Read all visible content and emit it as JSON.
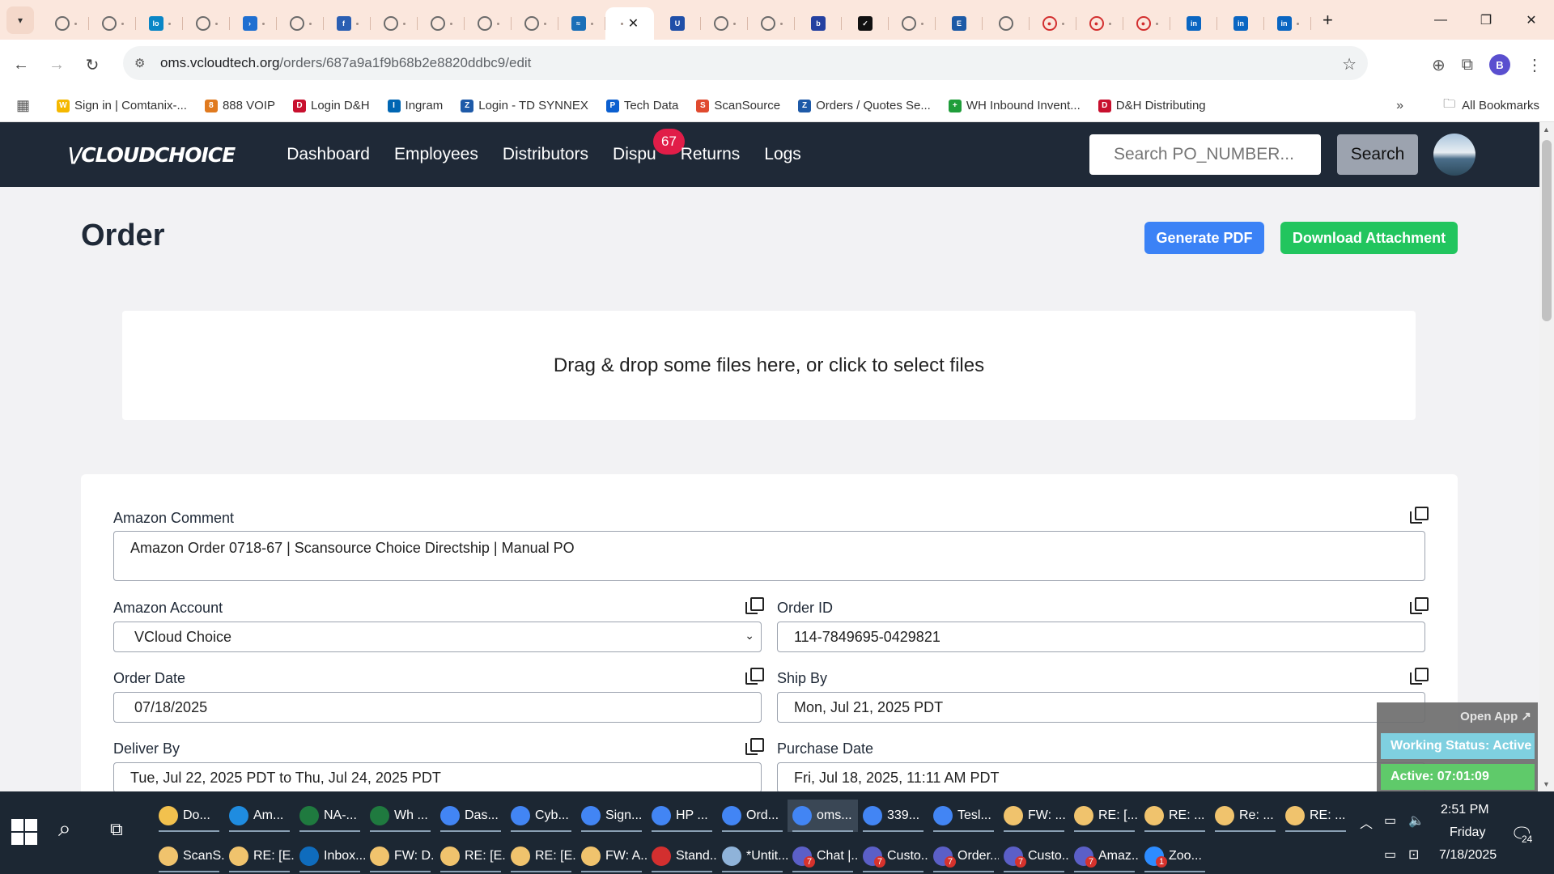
{
  "browser": {
    "active_tab_close": "✕",
    "new_tab": "+",
    "url_host": "oms.vcloudtech.org",
    "url_path": "/orders/687a9a1f9b68b2e8820ddbc9/edit",
    "profile_initial": "B",
    "bookmarks": [
      {
        "label": "Sign in | Comtanix-...",
        "color": "#f5b800",
        "glyph": "W"
      },
      {
        "label": "888 VOIP",
        "color": "#e07a1f",
        "glyph": "8"
      },
      {
        "label": "Login D&H",
        "color": "#c8102e",
        "glyph": "D"
      },
      {
        "label": "Ingram",
        "color": "#0066b3",
        "glyph": "I"
      },
      {
        "label": "Login - TD SYNNEX",
        "color": "#1e5aa8",
        "glyph": "Z"
      },
      {
        "label": "Tech Data",
        "color": "#0b5fd0",
        "glyph": "P"
      },
      {
        "label": "ScanSource",
        "color": "#e04a2f",
        "glyph": "S"
      },
      {
        "label": "Orders / Quotes Se...",
        "color": "#1e5aa8",
        "glyph": "Z"
      },
      {
        "label": "WH Inbound Invent...",
        "color": "#1f9d3a",
        "glyph": "+"
      },
      {
        "label": "D&H Distributing",
        "color": "#c8102e",
        "glyph": "D"
      }
    ],
    "bookmarks_more": "»",
    "all_bookmarks": "All Bookmarks"
  },
  "app": {
    "logo": "\\/CLOUDCHOICE",
    "nav": [
      "Dashboard",
      "Employees",
      "Distributors",
      "Dispu",
      "Returns",
      "Logs"
    ],
    "disputes_badge": "67",
    "search_placeholder": "Search PO_NUMBER...",
    "search_button": "Search"
  },
  "page": {
    "title": "Order",
    "generate_pdf": "Generate PDF",
    "download_attachment": "Download Attachment",
    "dropzone_text": "Drag & drop some files here, or click to select files"
  },
  "form": {
    "amazon_comment_label": "Amazon Comment",
    "amazon_comment_value": "Amazon Order 0718-67 | Scansource Choice Directship | Manual PO",
    "amazon_account_label": "Amazon Account",
    "amazon_account_value": "VCloud Choice",
    "order_id_label": "Order ID",
    "order_id_value": "114-7849695-0429821",
    "order_date_label": "Order Date",
    "order_date_value": "07/18/2025",
    "ship_by_label": "Ship By",
    "ship_by_value": "Mon, Jul 21, 2025 PDT",
    "deliver_by_label": "Deliver By",
    "deliver_by_value": "Tue, Jul 22, 2025 PDT to Thu, Jul 24, 2025 PDT",
    "purchase_date_label": "Purchase Date",
    "purchase_date_value": "Fri, Jul 18, 2025, 11:11 AM PDT"
  },
  "widget": {
    "open_app": "Open App ↗",
    "working_status": "Working Status: Active",
    "active_timer": "Active: 07:01:09"
  },
  "taskbar": {
    "row1": [
      {
        "label": "Do...",
        "color": "#f2c14e"
      },
      {
        "label": "Am...",
        "color": "#1f8ce0"
      },
      {
        "label": "NA-...",
        "color": "#1f7a3f"
      },
      {
        "label": "Wh ...",
        "color": "#1f7a3f"
      },
      {
        "label": "Das...",
        "color": "#4285f4"
      },
      {
        "label": "Cyb...",
        "color": "#4285f4"
      },
      {
        "label": "Sign...",
        "color": "#4285f4"
      },
      {
        "label": "HP ...",
        "color": "#4285f4"
      },
      {
        "label": "Ord...",
        "color": "#4285f4"
      },
      {
        "label": "oms...",
        "color": "#4285f4"
      },
      {
        "label": "339...",
        "color": "#4285f4"
      },
      {
        "label": "Tesl...",
        "color": "#4285f4"
      },
      {
        "label": "FW: ...",
        "color": "#f0c36d"
      },
      {
        "label": "RE: [...",
        "color": "#f0c36d"
      },
      {
        "label": "RE: ...",
        "color": "#f0c36d"
      },
      {
        "label": "Re: ...",
        "color": "#f0c36d"
      },
      {
        "label": "RE: ...",
        "color": "#f0c36d"
      }
    ],
    "row2": [
      {
        "label": "ScanS...",
        "color": "#f0c36d",
        "count": ""
      },
      {
        "label": "RE: [E...",
        "color": "#f0c36d",
        "count": ""
      },
      {
        "label": "Inbox...",
        "color": "#0f6cbd",
        "count": ""
      },
      {
        "label": "FW: D...",
        "color": "#f0c36d",
        "count": ""
      },
      {
        "label": "RE: [E...",
        "color": "#f0c36d",
        "count": ""
      },
      {
        "label": "RE: [E...",
        "color": "#f0c36d",
        "count": ""
      },
      {
        "label": "FW: A...",
        "color": "#f0c36d",
        "count": ""
      },
      {
        "label": "Stand...",
        "color": "#d32f2f",
        "count": ""
      },
      {
        "label": "*Untit...",
        "color": "#8fb3d9",
        "count": ""
      },
      {
        "label": "Chat |...",
        "color": "#5b5fc7",
        "count": "7"
      },
      {
        "label": "Custo...",
        "color": "#5b5fc7",
        "count": "7"
      },
      {
        "label": "Order...",
        "color": "#5b5fc7",
        "count": "7"
      },
      {
        "label": "Custo...",
        "color": "#5b5fc7",
        "count": "7"
      },
      {
        "label": "Amaz...",
        "color": "#5b5fc7",
        "count": "7"
      },
      {
        "label": "Zoo...",
        "color": "#2d8cff",
        "count": "1"
      }
    ],
    "time": "2:51 PM",
    "day": "Friday",
    "date": "7/18/2025",
    "notifications": "24"
  }
}
